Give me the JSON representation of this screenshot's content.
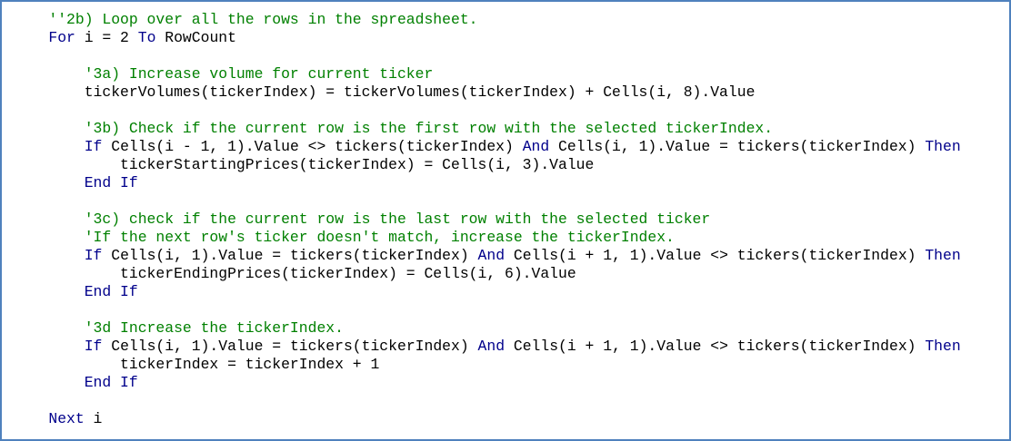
{
  "colors": {
    "border": "#4f81bd",
    "comment": "#008000",
    "keyword": "#00008b",
    "text": "#000000",
    "background": "#ffffff"
  },
  "code_lines": [
    {
      "indent": 1,
      "tokens": [
        {
          "t": "cm",
          "v": "''2b) Loop over all the rows in the spreadsheet."
        }
      ]
    },
    {
      "indent": 1,
      "tokens": [
        {
          "t": "kw",
          "v": "For"
        },
        {
          "t": "tx",
          "v": " i = 2 "
        },
        {
          "t": "kw",
          "v": "To"
        },
        {
          "t": "tx",
          "v": " RowCount"
        }
      ]
    },
    {
      "indent": 0,
      "tokens": []
    },
    {
      "indent": 2,
      "tokens": [
        {
          "t": "cm",
          "v": "'3a) Increase volume for current ticker"
        }
      ]
    },
    {
      "indent": 2,
      "tokens": [
        {
          "t": "tx",
          "v": "tickerVolumes(tickerIndex) = tickerVolumes(tickerIndex) + Cells(i, 8).Value"
        }
      ]
    },
    {
      "indent": 0,
      "tokens": []
    },
    {
      "indent": 2,
      "tokens": [
        {
          "t": "cm",
          "v": "'3b) Check if the current row is the first row with the selected tickerIndex."
        }
      ]
    },
    {
      "indent": 2,
      "tokens": [
        {
          "t": "kw",
          "v": "If"
        },
        {
          "t": "tx",
          "v": " Cells(i - 1, 1).Value <> tickers(tickerIndex) "
        },
        {
          "t": "kw",
          "v": "And"
        },
        {
          "t": "tx",
          "v": " Cells(i, 1).Value = tickers(tickerIndex) "
        },
        {
          "t": "kw",
          "v": "Then"
        }
      ]
    },
    {
      "indent": 3,
      "tokens": [
        {
          "t": "tx",
          "v": "tickerStartingPrices(tickerIndex) = Cells(i, 3).Value"
        }
      ]
    },
    {
      "indent": 2,
      "tokens": [
        {
          "t": "kw",
          "v": "End If"
        }
      ]
    },
    {
      "indent": 0,
      "tokens": []
    },
    {
      "indent": 2,
      "tokens": [
        {
          "t": "cm",
          "v": "'3c) check if the current row is the last row with the selected ticker"
        }
      ]
    },
    {
      "indent": 2,
      "tokens": [
        {
          "t": "cm",
          "v": "'If the next row's ticker doesn't match, increase the tickerIndex."
        }
      ]
    },
    {
      "indent": 2,
      "tokens": [
        {
          "t": "kw",
          "v": "If"
        },
        {
          "t": "tx",
          "v": " Cells(i, 1).Value = tickers(tickerIndex) "
        },
        {
          "t": "kw",
          "v": "And"
        },
        {
          "t": "tx",
          "v": " Cells(i + 1, 1).Value <> tickers(tickerIndex) "
        },
        {
          "t": "kw",
          "v": "Then"
        }
      ]
    },
    {
      "indent": 3,
      "tokens": [
        {
          "t": "tx",
          "v": "tickerEndingPrices(tickerIndex) = Cells(i, 6).Value"
        }
      ]
    },
    {
      "indent": 2,
      "tokens": [
        {
          "t": "kw",
          "v": "End If"
        }
      ]
    },
    {
      "indent": 0,
      "tokens": []
    },
    {
      "indent": 2,
      "tokens": [
        {
          "t": "cm",
          "v": "'3d Increase the tickerIndex."
        }
      ]
    },
    {
      "indent": 2,
      "tokens": [
        {
          "t": "kw",
          "v": "If"
        },
        {
          "t": "tx",
          "v": " Cells(i, 1).Value = tickers(tickerIndex) "
        },
        {
          "t": "kw",
          "v": "And"
        },
        {
          "t": "tx",
          "v": " Cells(i + 1, 1).Value <> tickers(tickerIndex) "
        },
        {
          "t": "kw",
          "v": "Then"
        }
      ]
    },
    {
      "indent": 3,
      "tokens": [
        {
          "t": "tx",
          "v": "tickerIndex = tickerIndex + 1"
        }
      ]
    },
    {
      "indent": 2,
      "tokens": [
        {
          "t": "kw",
          "v": "End If"
        }
      ]
    },
    {
      "indent": 0,
      "tokens": []
    },
    {
      "indent": 1,
      "tokens": [
        {
          "t": "kw",
          "v": "Next"
        },
        {
          "t": "tx",
          "v": " i"
        }
      ]
    }
  ]
}
